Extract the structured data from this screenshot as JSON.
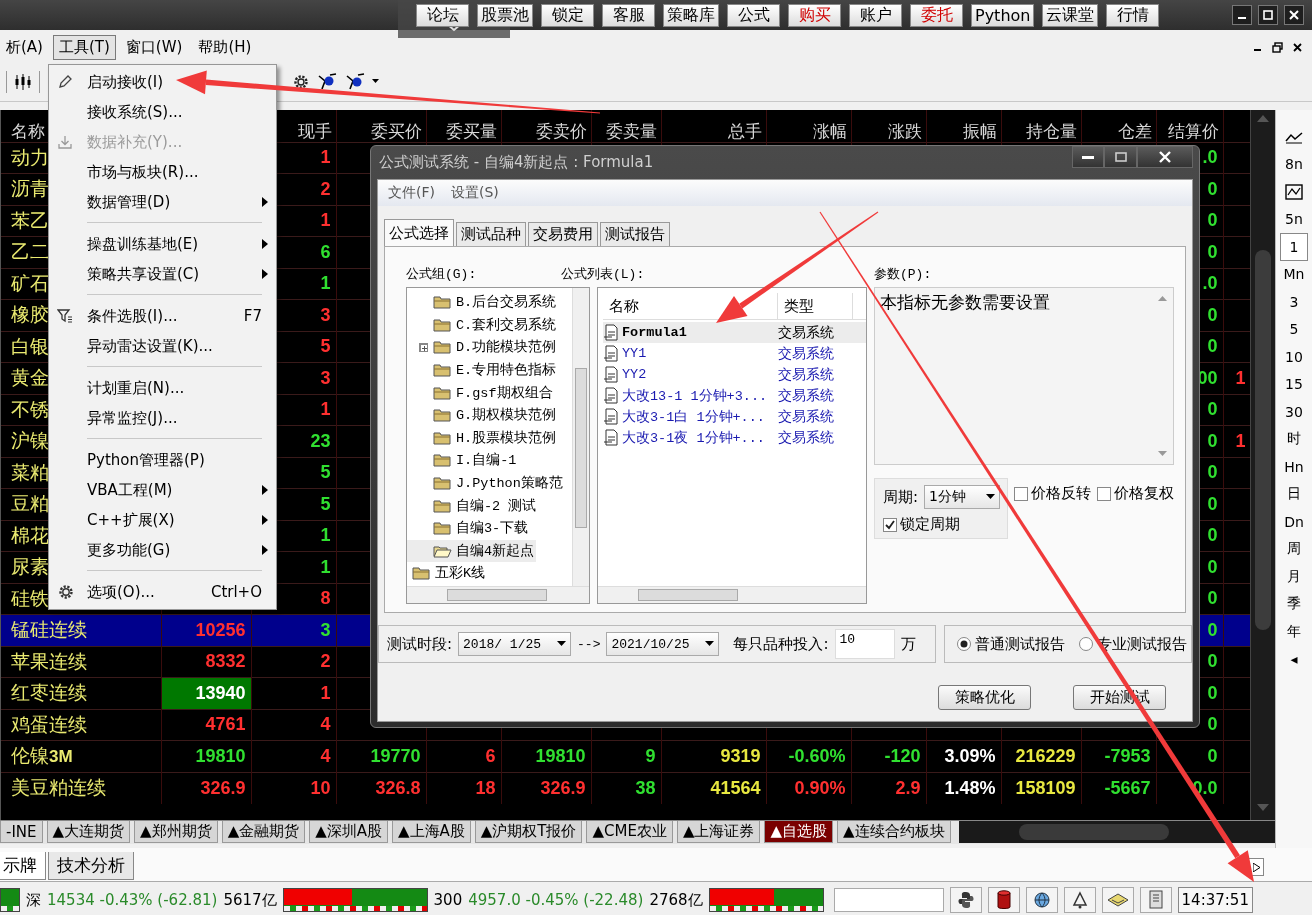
{
  "top_bar": {
    "buttons": [
      {
        "label": "论坛",
        "color": "#000000"
      },
      {
        "label": "股票池",
        "color": "#000000"
      },
      {
        "label": "锁定",
        "color": "#000000"
      },
      {
        "label": "客服",
        "color": "#000000"
      },
      {
        "label": "策略库",
        "color": "#000000"
      },
      {
        "label": "公式",
        "color": "#000000"
      },
      {
        "label": "购买",
        "color": "#d00000"
      },
      {
        "label": "账户",
        "color": "#000000"
      },
      {
        "label": "委托",
        "color": "#d00000"
      },
      {
        "label": "Python",
        "color": "#000000"
      },
      {
        "label": "云课堂",
        "color": "#000000"
      },
      {
        "label": "行情",
        "color": "#000000"
      }
    ]
  },
  "menu_bar": {
    "items": [
      {
        "label": "析(A)",
        "selected": false
      },
      {
        "label": "工具(T)",
        "selected": true
      },
      {
        "label": "窗口(W)",
        "selected": false
      },
      {
        "label": "帮助(H)",
        "selected": false
      }
    ]
  },
  "tools_menu": {
    "items": [
      {
        "kind": "item",
        "label": "启动接收(I)",
        "submenu": false,
        "disabled": false
      },
      {
        "kind": "item",
        "label": "接收系统(S)...",
        "submenu": false,
        "disabled": false
      },
      {
        "kind": "item",
        "label": "数据补充(Y)...",
        "submenu": false,
        "disabled": true
      },
      {
        "kind": "item",
        "label": "市场与板块(R)...",
        "submenu": false,
        "disabled": false
      },
      {
        "kind": "item",
        "label": "数据管理(D)",
        "submenu": true,
        "disabled": false
      },
      {
        "kind": "separator"
      },
      {
        "kind": "item",
        "label": "操盘训练基地(E)",
        "submenu": true,
        "disabled": false
      },
      {
        "kind": "item",
        "label": "策略共享设置(C)",
        "submenu": true,
        "disabled": false
      },
      {
        "kind": "separator"
      },
      {
        "kind": "item",
        "label": "条件选股(I)...",
        "shortcut": "F7",
        "submenu": false,
        "disabled": false
      },
      {
        "kind": "item",
        "label": "异动雷达设置(K)...",
        "submenu": false,
        "disabled": false
      },
      {
        "kind": "separator"
      },
      {
        "kind": "item",
        "label": "计划重启(N)...",
        "submenu": false,
        "disabled": false
      },
      {
        "kind": "item",
        "label": "异常监控(J)...",
        "submenu": false,
        "disabled": false
      },
      {
        "kind": "separator"
      },
      {
        "kind": "item",
        "label": "Python管理器(P)",
        "submenu": false,
        "disabled": false
      },
      {
        "kind": "item",
        "label": "VBA工程(M)",
        "submenu": true,
        "disabled": false
      },
      {
        "kind": "item",
        "label": "C++扩展(X)",
        "submenu": true,
        "disabled": false
      },
      {
        "kind": "item",
        "label": "更多功能(G)",
        "submenu": true,
        "disabled": false
      },
      {
        "kind": "separator"
      },
      {
        "kind": "item",
        "label": "选项(O)...",
        "shortcut": "Ctrl+O",
        "submenu": false,
        "disabled": false
      }
    ]
  },
  "table": {
    "columns": [
      "名称",
      null,
      "现手",
      "委买价",
      "委买量",
      "委卖价",
      "委卖量",
      "总手",
      "涨幅",
      "涨跌",
      "振幅",
      "持仓量",
      "仓差",
      "结算价",
      null
    ],
    "rows": [
      {
        "selected": false,
        "cells": [
          {
            "text": "动力"
          },
          null,
          {
            "text": "1",
            "color": "#ff3030",
            "highlight": false
          },
          null,
          null,
          null,
          null,
          null,
          null,
          null,
          null,
          null,
          null,
          {
            "text": ".0",
            "color": "#30e030",
            "highlight": false
          },
          null
        ]
      },
      {
        "selected": false,
        "cells": [
          {
            "text": "沥青"
          },
          null,
          {
            "text": "2",
            "color": "#ff3030",
            "highlight": false
          },
          null,
          null,
          null,
          null,
          null,
          null,
          null,
          null,
          null,
          null,
          {
            "text": "0",
            "color": "#30e030",
            "highlight": false
          },
          null
        ]
      },
      {
        "selected": false,
        "cells": [
          {
            "text": "苯乙"
          },
          null,
          {
            "text": "1",
            "color": "#ff3030",
            "highlight": false
          },
          null,
          null,
          null,
          null,
          null,
          null,
          null,
          null,
          null,
          null,
          {
            "text": "0",
            "color": "#30e030",
            "highlight": false
          },
          null
        ]
      },
      {
        "selected": false,
        "cells": [
          {
            "text": "乙二"
          },
          null,
          {
            "text": "6",
            "color": "#30e030",
            "highlight": false
          },
          null,
          null,
          null,
          null,
          null,
          null,
          null,
          null,
          null,
          null,
          {
            "text": "0",
            "color": "#30e030",
            "highlight": false
          },
          null
        ]
      },
      {
        "selected": false,
        "cells": [
          {
            "text": "矿石"
          },
          null,
          {
            "text": "1",
            "color": "#30e030",
            "highlight": false
          },
          null,
          null,
          null,
          null,
          null,
          null,
          null,
          null,
          null,
          null,
          {
            "text": ".0",
            "color": "#30e030",
            "highlight": false
          },
          null
        ]
      },
      {
        "selected": false,
        "cells": [
          {
            "text": "橡胶"
          },
          null,
          {
            "text": "3",
            "color": "#ff3030",
            "highlight": false
          },
          null,
          null,
          null,
          null,
          null,
          null,
          null,
          null,
          null,
          null,
          {
            "text": "0",
            "color": "#30e030",
            "highlight": false
          },
          null
        ]
      },
      {
        "selected": false,
        "cells": [
          {
            "text": "白银"
          },
          null,
          {
            "text": "5",
            "color": "#ff3030",
            "highlight": false
          },
          null,
          null,
          null,
          null,
          null,
          null,
          null,
          null,
          null,
          null,
          {
            "text": "0",
            "color": "#30e030",
            "highlight": false
          },
          null
        ]
      },
      {
        "selected": false,
        "cells": [
          {
            "text": "黄金"
          },
          null,
          {
            "text": "3",
            "color": "#ff3030",
            "highlight": false
          },
          null,
          null,
          null,
          null,
          null,
          null,
          null,
          null,
          null,
          null,
          {
            "text": "00",
            "color": "#30e030",
            "highlight": false
          },
          {
            "text": "1",
            "color": "#ff3030",
            "highlight": false
          }
        ]
      },
      {
        "selected": false,
        "cells": [
          {
            "text": "不锈"
          },
          null,
          {
            "text": "1",
            "color": "#ff3030",
            "highlight": false
          },
          null,
          null,
          null,
          null,
          null,
          null,
          null,
          null,
          null,
          null,
          {
            "text": "0",
            "color": "#30e030",
            "highlight": false
          },
          null
        ]
      },
      {
        "selected": false,
        "cells": [
          {
            "text": "沪镍"
          },
          null,
          {
            "text": "23",
            "color": "#30e030",
            "highlight": false
          },
          null,
          null,
          null,
          null,
          null,
          null,
          null,
          null,
          null,
          null,
          {
            "text": "0",
            "color": "#30e030",
            "highlight": false
          },
          {
            "text": "1",
            "color": "#ff3030",
            "highlight": false
          }
        ]
      },
      {
        "selected": false,
        "cells": [
          {
            "text": "菜粕"
          },
          null,
          {
            "text": "5",
            "color": "#30e030",
            "highlight": false
          },
          null,
          null,
          null,
          null,
          null,
          null,
          null,
          null,
          null,
          null,
          {
            "text": "0",
            "color": "#30e030",
            "highlight": false
          },
          null
        ]
      },
      {
        "selected": false,
        "cells": [
          {
            "text": "豆粕"
          },
          null,
          {
            "text": "5",
            "color": "#30e030",
            "highlight": false
          },
          null,
          null,
          null,
          null,
          null,
          null,
          null,
          null,
          null,
          null,
          {
            "text": "0",
            "color": "#30e030",
            "highlight": false
          },
          null
        ]
      },
      {
        "selected": false,
        "cells": [
          {
            "text": "棉花"
          },
          null,
          {
            "text": "1",
            "color": "#30e030",
            "highlight": false
          },
          null,
          null,
          null,
          null,
          null,
          null,
          null,
          null,
          null,
          null,
          {
            "text": "0",
            "color": "#30e030",
            "highlight": false
          },
          null
        ]
      },
      {
        "selected": false,
        "cells": [
          {
            "text": "尿素"
          },
          null,
          {
            "text": "1",
            "color": "#30e030",
            "highlight": false
          },
          null,
          null,
          null,
          null,
          null,
          null,
          null,
          null,
          null,
          null,
          {
            "text": "0",
            "color": "#30e030",
            "highlight": false
          },
          null
        ]
      },
      {
        "selected": false,
        "cells": [
          {
            "text": "硅铁"
          },
          null,
          {
            "text": "8",
            "color": "#ff3030",
            "highlight": false
          },
          null,
          null,
          null,
          null,
          null,
          null,
          null,
          null,
          null,
          null,
          {
            "text": "0",
            "color": "#30e030",
            "highlight": false
          },
          null
        ]
      },
      {
        "selected": true,
        "cells": [
          {
            "text": "锰硅连续"
          },
          {
            "text": "10256",
            "color": "#ff3030",
            "highlight": false
          },
          {
            "text": "3",
            "color": "#30e030",
            "highlight": false
          },
          null,
          null,
          null,
          null,
          null,
          null,
          null,
          null,
          null,
          null,
          {
            "text": "0",
            "color": "#30e030",
            "highlight": false
          },
          null
        ]
      },
      {
        "selected": false,
        "cells": [
          {
            "text": "苹果连续"
          },
          {
            "text": "8332",
            "color": "#ff3030",
            "highlight": false
          },
          {
            "text": "2",
            "color": "#ff3030",
            "highlight": false
          },
          null,
          null,
          null,
          null,
          null,
          null,
          null,
          null,
          null,
          null,
          {
            "text": "0",
            "color": "#30e030",
            "highlight": false
          },
          null
        ]
      },
      {
        "selected": false,
        "cells": [
          {
            "text": "红枣连续"
          },
          {
            "text": "13940",
            "color": "#ffffff",
            "highlight": true
          },
          {
            "text": "1",
            "color": "#ff3030",
            "highlight": false
          },
          null,
          null,
          null,
          null,
          null,
          null,
          null,
          null,
          null,
          null,
          {
            "text": "0",
            "color": "#30e030",
            "highlight": false
          },
          null
        ]
      },
      {
        "selected": false,
        "cells": [
          {
            "text": "鸡蛋连续"
          },
          {
            "text": "4761",
            "color": "#ff3030",
            "highlight": false
          },
          {
            "text": "4",
            "color": "#ff3030",
            "highlight": false
          },
          null,
          null,
          null,
          null,
          null,
          null,
          null,
          null,
          null,
          null,
          {
            "text": "0",
            "color": "#30e030",
            "highlight": false
          },
          null
        ]
      },
      {
        "selected": false,
        "cells": [
          {
            "text": "伦镍**3M**"
          },
          {
            "text": "19810",
            "color": "#30e030",
            "highlight": false
          },
          {
            "text": "4",
            "color": "#ff3030",
            "highlight": false
          },
          {
            "text": "19770",
            "color": "#30e030",
            "highlight": false
          },
          {
            "text": "6",
            "color": "#ff3030",
            "highlight": false
          },
          {
            "text": "19810",
            "color": "#30e030",
            "highlight": false
          },
          {
            "text": "9",
            "color": "#30e030",
            "highlight": false
          },
          {
            "text": "9319",
            "color": "#e8e840",
            "highlight": false
          },
          {
            "text": "-0.60%",
            "color": "#30e030",
            "highlight": false
          },
          {
            "text": "-120",
            "color": "#30e030",
            "highlight": false
          },
          {
            "text": "3.09%",
            "color": "#ffffff",
            "highlight": false
          },
          {
            "text": "216229",
            "color": "#e8e840",
            "highlight": false
          },
          {
            "text": "-7953",
            "color": "#30e030",
            "highlight": false
          },
          {
            "text": "0",
            "color": "#30e030",
            "highlight": false
          },
          null
        ]
      },
      {
        "selected": false,
        "cells": [
          {
            "text": "美豆粕连续"
          },
          {
            "text": "326.9",
            "color": "#ff3030",
            "highlight": false
          },
          {
            "text": "10",
            "color": "#ff3030",
            "highlight": false
          },
          {
            "text": "326.8",
            "color": "#ff3030",
            "highlight": false
          },
          {
            "text": "18",
            "color": "#ff3030",
            "highlight": false
          },
          {
            "text": "326.9",
            "color": "#ff3030",
            "highlight": false
          },
          {
            "text": "38",
            "color": "#30e030",
            "highlight": false
          },
          {
            "text": "41564",
            "color": "#e8e840",
            "highlight": false
          },
          {
            "text": "0.90%",
            "color": "#ff3030",
            "highlight": false
          },
          {
            "text": "2.9",
            "color": "#ff3030",
            "highlight": false
          },
          {
            "text": "1.48%",
            "color": "#ffffff",
            "highlight": false
          },
          {
            "text": "158109",
            "color": "#e8e840",
            "highlight": false
          },
          {
            "text": "-5667",
            "color": "#30e030",
            "highlight": false
          },
          {
            "text": "0.0",
            "color": "#30e030",
            "highlight": false
          },
          null
        ]
      }
    ]
  },
  "period_bar": {
    "items": [
      {
        "kind": "line",
        "selected": false
      },
      {
        "kind": "text",
        "label": "8n",
        "selected": false
      },
      {
        "kind": "chart",
        "selected": false
      },
      {
        "kind": "text",
        "label": "5n",
        "selected": false
      },
      {
        "kind": "text",
        "label": "1",
        "selected": true
      },
      {
        "kind": "text",
        "label": "Mn",
        "selected": false
      },
      {
        "kind": "text",
        "label": "3",
        "selected": false
      },
      {
        "kind": "text",
        "label": "5",
        "selected": false
      },
      {
        "kind": "text",
        "label": "10",
        "selected": false
      },
      {
        "kind": "text",
        "label": "15",
        "selected": false
      },
      {
        "kind": "text",
        "label": "30",
        "selected": false
      },
      {
        "kind": "text",
        "label": "时",
        "selected": false
      },
      {
        "kind": "text",
        "label": "Hn",
        "selected": false
      },
      {
        "kind": "text",
        "label": "日",
        "selected": false
      },
      {
        "kind": "text",
        "label": "Dn",
        "selected": false
      },
      {
        "kind": "text",
        "label": "周",
        "selected": false
      },
      {
        "kind": "text",
        "label": "月",
        "selected": false
      },
      {
        "kind": "text",
        "label": "季",
        "selected": false
      },
      {
        "kind": "text",
        "label": "年",
        "selected": false
      },
      {
        "kind": "text",
        "label": "◂",
        "selected": false
      }
    ]
  },
  "sheet_tabs": [
    {
      "label": "-INE",
      "selected": false
    },
    {
      "label": "▲大连期货",
      "selected": false
    },
    {
      "label": "▲郑州期货",
      "selected": false
    },
    {
      "label": "▲金融期货",
      "selected": false
    },
    {
      "label": "▲深圳A股",
      "selected": false
    },
    {
      "label": "▲上海A股",
      "selected": false
    },
    {
      "label": "▲沪期权T报价",
      "selected": false
    },
    {
      "label": "▲CME农业",
      "selected": false
    },
    {
      "label": "▲上海证券",
      "selected": false
    },
    {
      "label": "▲自选股",
      "selected": true
    },
    {
      "label": "▲连续合约板块",
      "selected": false
    }
  ],
  "view_tabs": [
    {
      "label": "示牌",
      "selected": true
    },
    {
      "label": "技术分析",
      "selected": false
    }
  ],
  "status_bar": {
    "indices": [
      {
        "label": "深",
        "value": "14534 -0.43% (-62.81)",
        "amount": "5617亿",
        "level": 0.48
      },
      {
        "label": "300",
        "value": "4957.0 -0.45% (-22.48)",
        "amount": "2768亿",
        "level": 0.57
      }
    ],
    "time": "14:37:51"
  },
  "dialog": {
    "title": "公式测试系统 - 自编4新起点 : Formula1",
    "menu": [
      "文件(F)",
      "设置(S)"
    ],
    "tabs": [
      {
        "label": "公式选择",
        "selected": true
      },
      {
        "label": "测试品种",
        "selected": false
      },
      {
        "label": "交易费用",
        "selected": false
      },
      {
        "label": "测试报告",
        "selected": false
      }
    ],
    "group_label": "公式组(G):",
    "list_label": "公式列表(L):",
    "params_label": "参数(P):",
    "tree": [
      {
        "children": [
          {
            "label": "B.后台交易系统",
            "selected": false,
            "collapsed": false
          },
          {
            "label": "C.套利交易系统",
            "selected": false,
            "collapsed": false
          },
          {
            "label": "D.功能模块范例",
            "selected": false,
            "collapsed": true
          },
          {
            "label": "E.专用特色指标",
            "selected": false,
            "collapsed": false
          },
          {
            "label": "F.gsf期权组合",
            "selected": false,
            "collapsed": false
          },
          {
            "label": "G.期权模块范例",
            "selected": false,
            "collapsed": false
          },
          {
            "label": "H.股票模块范例",
            "selected": false,
            "collapsed": false
          },
          {
            "label": "I.自编-1",
            "selected": false,
            "collapsed": false
          },
          {
            "label": "J.Python策略范",
            "selected": false,
            "collapsed": false
          },
          {
            "label": "自编-2 测试",
            "selected": false,
            "collapsed": false
          },
          {
            "label": "自编3-下载",
            "selected": false,
            "collapsed": false
          },
          {
            "label": "自编4新起点",
            "selected": true,
            "collapsed": false
          }
        ]
      },
      {
        "label": "五彩K线",
        "selected": false
      }
    ],
    "formula_list": {
      "columns": [
        "名称",
        "类型"
      ],
      "rows": [
        {
          "name": "Formula1",
          "type": "交易系统",
          "selected": true
        },
        {
          "name": "YY1",
          "type": "交易系统",
          "selected": false
        },
        {
          "name": "YY2",
          "type": "交易系统",
          "selected": false
        },
        {
          "name": "大改13-1 1分钟+3...",
          "type": "交易系统",
          "selected": false
        },
        {
          "name": "大改3-1白 1分钟+...",
          "type": "交易系统",
          "selected": false
        },
        {
          "name": "大改3-1夜 1分钟+...",
          "type": "交易系统",
          "selected": false
        }
      ]
    },
    "params_text": "本指标无参数需要设置",
    "period": {
      "label": "周期:",
      "value": "1分钟"
    },
    "options": [
      {
        "label": "价格反转",
        "checked": false
      },
      {
        "label": "价格复权",
        "checked": false
      },
      {
        "label": "锁定周期",
        "checked": true
      }
    ],
    "range": {
      "label": "测试时段:",
      "start": "2018/ 1/25",
      "arrow": "-->",
      "end": "2021/10/25"
    },
    "investment": {
      "label": "每只品种投入:",
      "value": "10",
      "unit": "万"
    },
    "report_types": [
      {
        "label": "普通测试报告",
        "selected": true
      },
      {
        "label": "专业测试报告",
        "selected": false
      }
    ],
    "buttons": [
      "策略优化",
      "开始测试"
    ]
  }
}
